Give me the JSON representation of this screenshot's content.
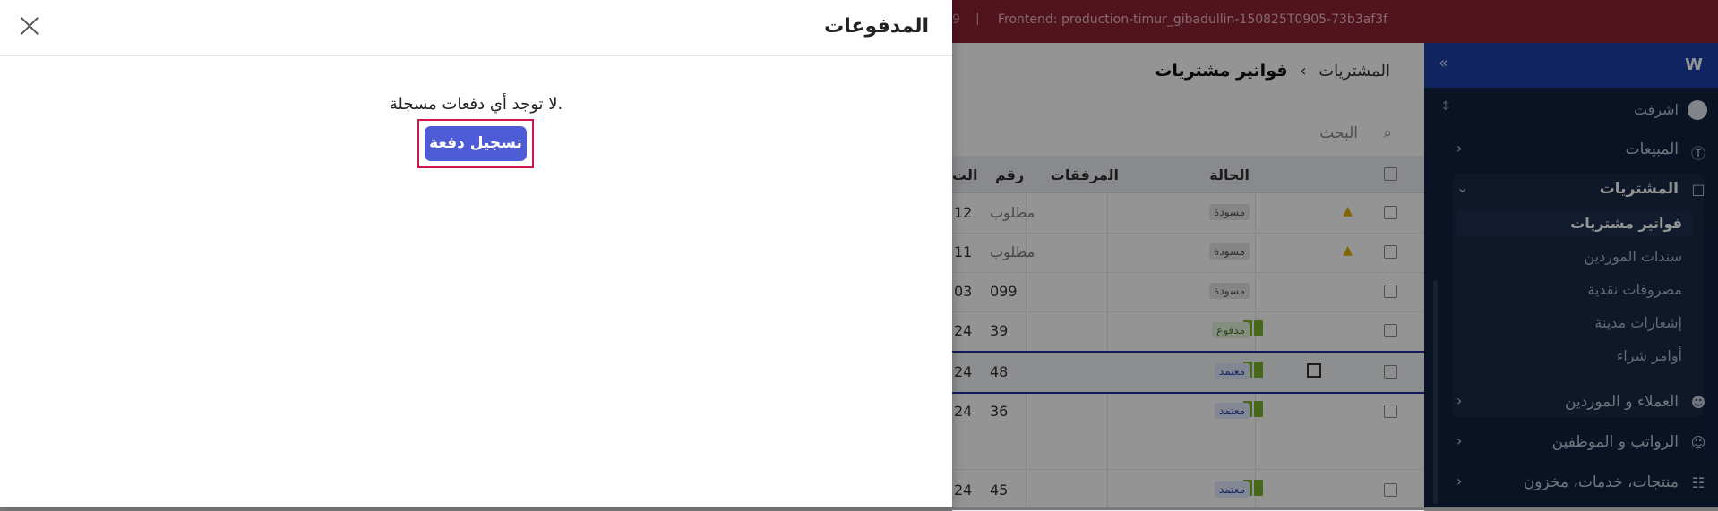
{
  "banner": {
    "left_num": "9",
    "separator": "|",
    "frontend": "Frontend: production-timur_gibadullin-150825T0905-73b3af3f"
  },
  "sidebar": {
    "org_name": "اشرفت",
    "items": [
      {
        "label": "المبيعات",
        "icon": "dollar-icon"
      },
      {
        "label": "المشتريات",
        "icon": "bag-icon"
      },
      {
        "label": "العملاء و الموردين",
        "icon": "users-icon"
      },
      {
        "label": "الرواتب و الموظفين",
        "icon": "employees-icon"
      },
      {
        "label": "منتجات، خدمات، مخزون",
        "icon": "barcode-icon"
      }
    ],
    "sub_items": [
      "فواتير مشتريات",
      "سندات الموردين",
      "مصروفات نقدية",
      "إشعارات مدينة",
      "أوامر شراء"
    ]
  },
  "main": {
    "breadcrumb_parent": "المشتريات",
    "breadcrumb_sep": "›",
    "breadcrumb_current": "فواتير مشتريات",
    "search_placeholder": "البحث",
    "columns": {
      "status": "الحالة",
      "attachments": "المرفقات",
      "number": "رقم",
      "next": "الت"
    },
    "rows": [
      {
        "status": "مسودة",
        "status_type": "draft",
        "number": "مطلوب",
        "lead": "12",
        "warn": true
      },
      {
        "status": "مسودة",
        "status_type": "draft",
        "number": "مطلوب",
        "lead": "11",
        "warn": true
      },
      {
        "status": "مسودة",
        "status_type": "draft",
        "number": "099",
        "lead": "03"
      },
      {
        "status": "مدفوع",
        "status_type": "paid",
        "number": "39",
        "lead": "24",
        "book": true
      },
      {
        "status": "معتمد",
        "status_type": "approved",
        "number": "48",
        "lead": "24",
        "book": true,
        "selected": true
      },
      {
        "status": "معتمد",
        "status_type": "approved",
        "number": "36",
        "lead": "24",
        "book": true
      },
      {
        "status": "معتمد",
        "status_type": "approved",
        "number": "45",
        "lead": "24",
        "book": true
      }
    ]
  },
  "panel": {
    "title": "المدفوعات",
    "empty_text": "لا توجد أي دفعات مسجلة.",
    "record_button": "تسجيل دفعة"
  }
}
